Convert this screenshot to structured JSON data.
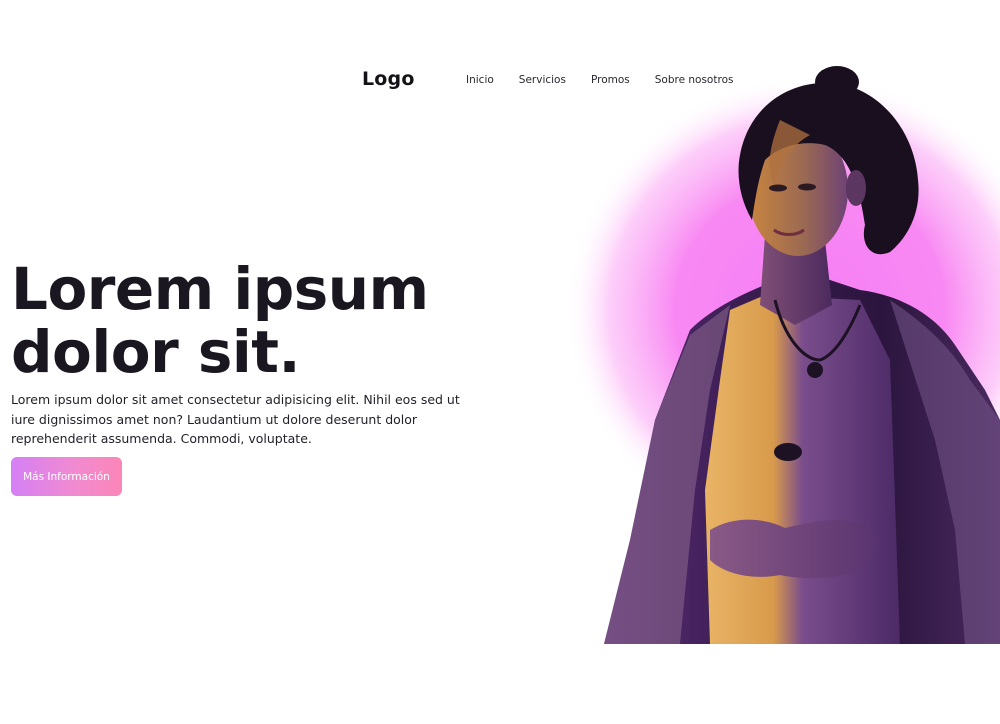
{
  "header": {
    "logo": "Logo",
    "nav": [
      {
        "label": "Inicio"
      },
      {
        "label": "Servicios"
      },
      {
        "label": "Promos"
      },
      {
        "label": "Sobre nosotros"
      }
    ]
  },
  "hero": {
    "title_line1": "Lorem ipsum",
    "title_line2": "dolor sit.",
    "description": "Lorem ipsum dolor sit amet consectetur adipisicing elit. Nihil eos sed ut iure dignissimos amet non? Laudantium ut dolore deserunt dolor reprehenderit assumenda. Commodi, voluptate.",
    "cta_label": "Más Información",
    "image": {
      "subject": "woman in sheer lace jacket lit in purple and orange light",
      "glow_color": "#f57ef5"
    }
  },
  "colors": {
    "text": "#1b1720",
    "button_gradient_start": "#d47ff5",
    "button_gradient_end": "#fb86b8",
    "glow": "#f57ef5",
    "shadow_purple": "#2a1538",
    "highlight_orange": "#e7a24a"
  }
}
